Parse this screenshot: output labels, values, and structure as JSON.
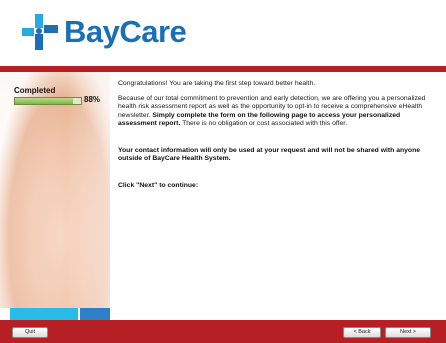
{
  "brand": {
    "name": "BayCare",
    "color": "#1a6fb5",
    "accent": "#b61f24"
  },
  "progress": {
    "label": "Completed",
    "percent_text": "88%",
    "fraction": 0.88
  },
  "content": {
    "p1": "Congratulations! You are taking the first step toward better health.",
    "p2a": "Because of our total commitment to prevention and early detection, we are offering you a personalized health risk assessment report as well as the opportunity to opt-in to receive a comprehensive eHealth newsletter. ",
    "p2b": "Simply complete the form on the following page to access your personalized assessment report.",
    "p2c": " There is no obligation or cost associated with this offer.",
    "p3": "Your contact information will only be used at your request and will not be shared with anyone outside of BayCare Health System.",
    "p4": "Click \"Next\" to continue:"
  },
  "footer": {
    "quit_label": "Quit",
    "back_label": "< Back",
    "next_label": "Next >"
  }
}
